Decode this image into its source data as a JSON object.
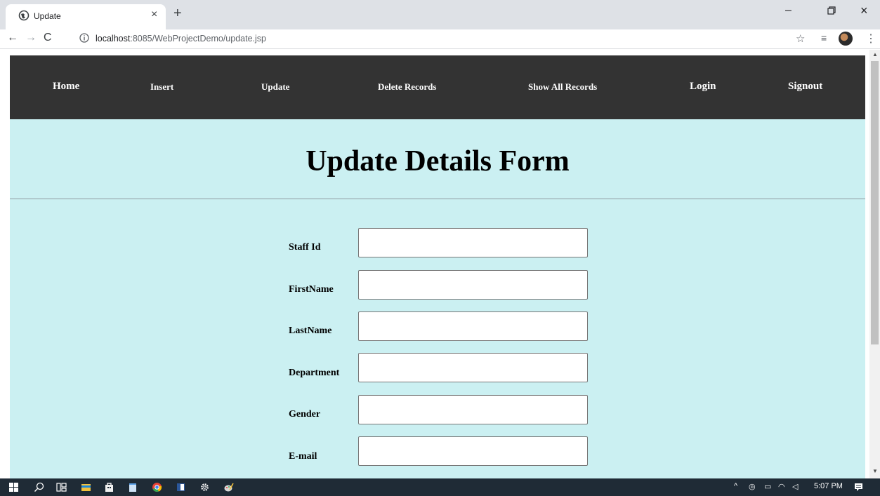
{
  "browser": {
    "tab_title": "Update",
    "new_tab_symbol": "+",
    "close_tab_symbol": "×",
    "url_host": "localhost",
    "url_path": ":8085/WebProjectDemo/update.jsp",
    "window_controls": {
      "minimize": "–",
      "close": "×"
    },
    "nav_symbols": {
      "back": "←",
      "forward": "→",
      "reload": "C"
    },
    "icons": [
      "globe-icon",
      "info-icon",
      "star-icon",
      "media-control-icon",
      "profile-avatar",
      "menu-dots-icon"
    ]
  },
  "navbar": {
    "links": [
      "Home",
      "Insert",
      "Update",
      "Delete Records",
      "Show All Records",
      "Login",
      "Signout"
    ]
  },
  "form": {
    "title": "Update Details Form",
    "fields": [
      {
        "label": "Staff Id",
        "value": ""
      },
      {
        "label": "FirstName",
        "value": ""
      },
      {
        "label": "LastName",
        "value": ""
      },
      {
        "label": "Department",
        "value": ""
      },
      {
        "label": "Gender",
        "value": ""
      },
      {
        "label": "E-mail",
        "value": ""
      }
    ]
  },
  "taskbar": {
    "clock": "5:07 PM",
    "icons": [
      "windows-start-icon",
      "search-icon",
      "task-view-icon",
      "file-explorer-icon",
      "store-icon",
      "notepad-icon",
      "chrome-icon",
      "word-icon",
      "settings-icon",
      "paint-icon"
    ]
  },
  "colors": {
    "page_background": "#cbf0f2",
    "navbar_background": "#333333",
    "taskbar_background": "#1f2b36"
  }
}
